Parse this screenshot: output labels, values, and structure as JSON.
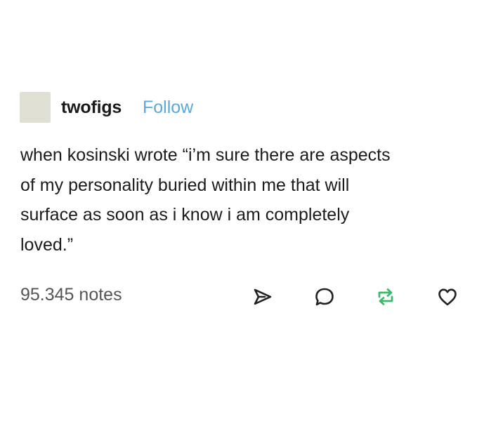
{
  "post": {
    "username": "twofigs",
    "follow_label": "Follow",
    "body_lines": [
      "when kosinski wrote “i’m sure there are aspects",
      "of my personality buried within me that will",
      "surface as soon as i know i am completely",
      "loved.”"
    ],
    "notes": "95.345 notes"
  },
  "actions": [
    {
      "icon": "share-icon"
    },
    {
      "icon": "reply-icon"
    },
    {
      "icon": "reblog-icon"
    },
    {
      "icon": "like-icon"
    }
  ],
  "colors": {
    "follow": "#5aa9d8",
    "reblog": "#3cb96b",
    "text": "#1b1b1b",
    "muted": "#555555",
    "avatar": "#dfe0d3"
  }
}
